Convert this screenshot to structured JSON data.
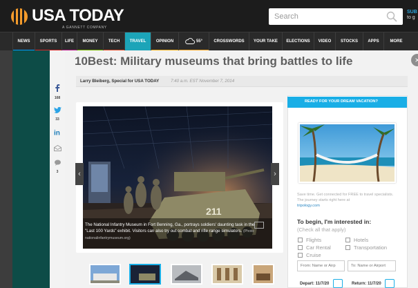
{
  "masthead": {
    "logo_text": "USA TODAY",
    "logo_subtitle": "A GANNETT COMPANY",
    "search_placeholder": "Search",
    "subscribe_label": "SUB",
    "subscribe_sub": "to g"
  },
  "nav": {
    "items": [
      "NEWS",
      "SPORTS",
      "LIFE",
      "MONEY",
      "TECH",
      "TRAVEL",
      "OPINION",
      "55°",
      "CROSSWORDS",
      "YOUR TAKE",
      "ELECTIONS",
      "VIDEO",
      "STOCKS",
      "APPS",
      "MORE"
    ],
    "active_item": "TRAVEL",
    "accent_colors": {
      "NEWS": "#009bff",
      "SPORTS": "#d62727",
      "LIFE": "#b91a8a",
      "MONEY": "#7ab800",
      "TECH": "#e24d2b",
      "TRAVEL": "#1ca4b8",
      "OPINION": "#f2b219",
      "55°": "#f5a623",
      "CROSSWORDS": "#7b7b7b",
      "YOUR TAKE": "#7b7b7b",
      "ELECTIONS": "#7b7b7b",
      "VIDEO": "#7b7b7b",
      "STOCKS": "#7b7b7b",
      "APPS": "#7b7b7b",
      "MORE": "#7b7b7b"
    },
    "weather_icon": "cloud-icon"
  },
  "share": {
    "facebook_count": "168",
    "twitter_count": "33",
    "comment_count": "3",
    "icons": [
      "facebook-icon",
      "twitter-icon",
      "linkedin-icon",
      "email-icon",
      "comment-icon"
    ]
  },
  "article": {
    "headline": "10Best: Military museums that bring battles to life",
    "byline": "Larry Bleiberg, Special for USA TODAY",
    "dateline": "7:40 a.m. EST November 7, 2014",
    "caption": "The National Infantry Museum in Fort Benning, Ga., portrays soldiers' daunting task in the \"Last 100 Yards\" exhibit. Visitors can also try out combat and rifle range simulators.",
    "caption_credit": "(Photo: nationalinfantrymuseum.org)",
    "photo_vehicle_number": "211",
    "active_thumbnail": 2
  },
  "ad": {
    "ribbon": "READY FOR YOUR DREAM VACATION?",
    "copy": "Save time. Get connected for FREE to travel specialists. The journey starts right here at",
    "link": "tripology.com",
    "heading": "To begin, I'm interested in:",
    "subheading": "(Check all that apply)",
    "options": [
      "Flights",
      "Hotels",
      "Car Rental",
      "Transportation",
      "Cruise"
    ],
    "from_placeholder": "From: Name or Airp",
    "to_placeholder": "To: Name or Airport",
    "depart_label": "Depart: 11/7/20",
    "return_label": "Return: 11/7/20"
  },
  "colors": {
    "brand_accent": "#19aee6",
    "masthead_bg": "#1c1c1c",
    "globe": "#f49b2c"
  }
}
